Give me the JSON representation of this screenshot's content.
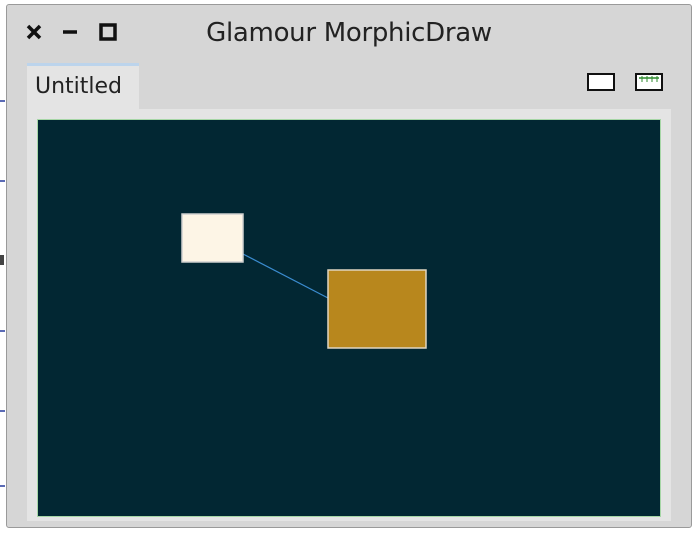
{
  "window": {
    "title": "Glamour MorphicDraw",
    "controls": [
      "close-icon",
      "minimize-icon",
      "maximize-icon"
    ]
  },
  "tabs": [
    {
      "label": "Untitled",
      "active": true
    }
  ],
  "toolbar": {
    "icons": [
      "rectangle-tool-icon",
      "text-tool-icon"
    ]
  },
  "canvas": {
    "background": "#022733",
    "border": "#a6d6a6",
    "shapes": [
      {
        "name": "cream-rectangle",
        "fill": "#fdf5e6",
        "stroke": "#d0d0d0"
      },
      {
        "name": "gold-rectangle",
        "fill": "#b8871d",
        "stroke": "#e0d6c2"
      }
    ],
    "connector": {
      "color": "#3b8cd0"
    }
  }
}
